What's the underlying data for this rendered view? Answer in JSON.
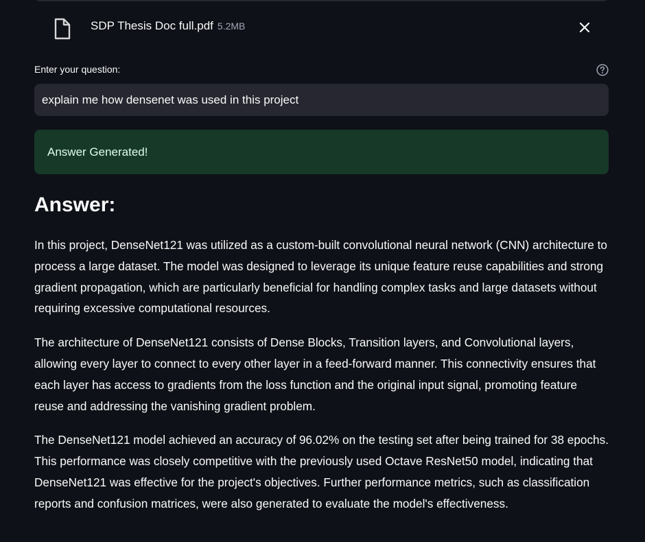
{
  "uploaded_file": {
    "name": "SDP Thesis Doc full.pdf",
    "size": "5.2MB",
    "file_icon": "file-icon",
    "remove_icon": "close-icon"
  },
  "question": {
    "label": "Enter your question:",
    "help_icon": "question-circle-icon",
    "value": "explain me how densenet was used in this project"
  },
  "status": {
    "message": "Answer Generated!",
    "color": "#173928"
  },
  "answer": {
    "heading": "Answer:",
    "paragraphs": [
      "In this project, DenseNet121 was utilized as a custom-built convolutional neural network (CNN) architecture to process a large dataset. The model was designed to leverage its unique feature reuse capabilities and strong gradient propagation, which are particularly beneficial for handling complex tasks and large datasets without requiring excessive computational resources.",
      "The architecture of DenseNet121 consists of Dense Blocks, Transition layers, and Convolutional layers, allowing every layer to connect to every other layer in a feed-forward manner. This connectivity ensures that each layer has access to gradients from the loss function and the original input signal, promoting feature reuse and addressing the vanishing gradient problem.",
      "The DenseNet121 model achieved an accuracy of 96.02% on the testing set after being trained for 38 epochs. This performance was closely competitive with the previously used Octave ResNet50 model, indicating that DenseNet121 was effective for the project's objectives. Further performance metrics, such as classification reports and confusion matrices, were also generated to evaluate the model's effectiveness."
    ]
  },
  "colors": {
    "background": "#0e1117",
    "input_background": "#262730",
    "success_background": "#173928",
    "success_text": "#dffde9",
    "text": "#fafafa"
  }
}
